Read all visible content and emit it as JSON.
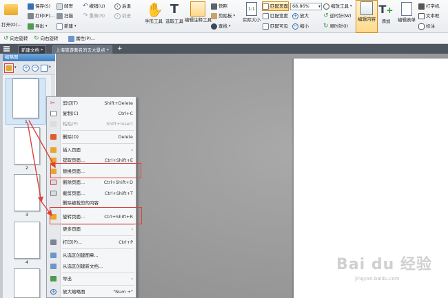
{
  "ribbon": {
    "open": "打开(O)...",
    "save": "保存(S)",
    "print": "打印(P)...",
    "export": "导出",
    "email": "邮寄",
    "scan": "扫描",
    "new": "新建",
    "undo": "撤销(U)",
    "redo": "重做(R)",
    "back": "后退",
    "forward": "前进",
    "hand_tool": "手形工具",
    "select_tool": "选取工具",
    "edit_annot": "编辑注释工具",
    "snapshot": "快照",
    "clipboard": "剪贴板",
    "find": "查找",
    "actual_size": "实际大小",
    "fit_page": "匹配页面",
    "fit_width": "匹配宽度",
    "fit_visible": "匹配可见",
    "zoom_value": "68.86%",
    "zoom_tool": "缩放工具",
    "zoom_in": "放大",
    "zoom_out": "缩小",
    "rotate_cw": "逆时针(W)",
    "rotate_ccw": "顺时针(I)",
    "edit_content": "编辑内容",
    "add": "添加",
    "edit_form": "编辑表单",
    "typewriter": "打字机",
    "textbox": "文本框",
    "callout": "标注"
  },
  "quickbar": {
    "rotate_left": "向左旋转",
    "rotate_right": "向右旋转",
    "properties": "属性(P)..."
  },
  "tabs": [
    {
      "label": "新建文档 *"
    },
    {
      "label": "上海旅游著名的五大景点 *"
    }
  ],
  "panel": {
    "title": "缩略图",
    "page_numbers": [
      "1",
      "2",
      "3",
      "4"
    ]
  },
  "context_menu": [
    {
      "label": "剪切(T)",
      "shortcut": "Shift+Delete"
    },
    {
      "label": "复制(C)",
      "shortcut": "Ctrl+C"
    },
    {
      "label": "粘贴(P)",
      "shortcut": "Shift+Insert"
    },
    {
      "label": "删除(D)",
      "shortcut": "Delete"
    },
    {
      "label": "插入页面",
      "shortcut": "›"
    },
    {
      "label": "提取页面...",
      "shortcut": "Ctrl+Shift+E"
    },
    {
      "label": "替换页面...",
      "shortcut": ""
    },
    {
      "label": "删除页面...",
      "shortcut": "Ctrl+Shift+D"
    },
    {
      "label": "截剪页面...",
      "shortcut": "Ctrl+Shift+T"
    },
    {
      "label": "删除被裁剪的内容",
      "shortcut": ""
    },
    {
      "label": "旋转页面...",
      "shortcut": "Ctrl+Shift+R"
    },
    {
      "label": "更多页面",
      "shortcut": "›"
    },
    {
      "label": "打印(P)...",
      "shortcut": "Ctrl+P"
    },
    {
      "label": "从选区创建图章...",
      "shortcut": ""
    },
    {
      "label": "从选区创建新文档...",
      "shortcut": ""
    },
    {
      "label": "导出",
      "shortcut": "›"
    },
    {
      "label": "放大缩略图",
      "shortcut": "\"Num +\""
    }
  ],
  "watermark": {
    "brand": "Bai du 经验",
    "url": "jingyan.baidu.com"
  },
  "colors": {
    "accent": "#3f7fc2",
    "highlight": "#e0403a",
    "tabbar": "#505660"
  }
}
